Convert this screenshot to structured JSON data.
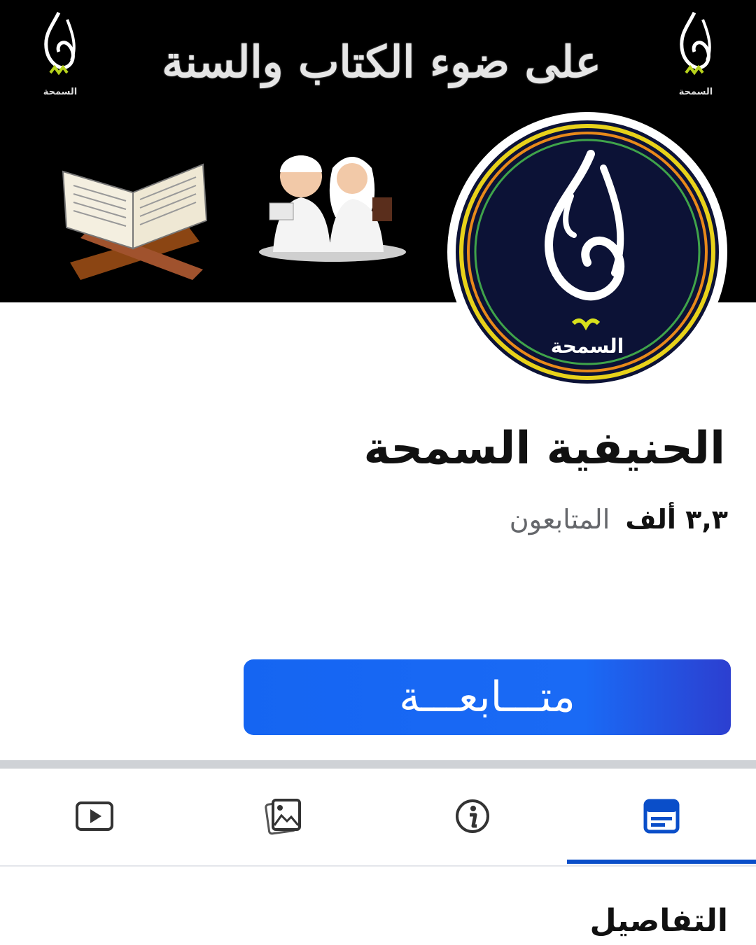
{
  "cover": {
    "title": "على ضوء الكتاب والسنة",
    "corner_logo_text": "السمحة"
  },
  "profile": {
    "avatar_caption": "السمحة",
    "name": "الحنيفية السمحة",
    "followers_count": "٣,٣ ألف",
    "followers_label": "المتابعون"
  },
  "actions": {
    "follow_label": "متـــابعـــة"
  },
  "tabs": [
    {
      "icon": "video-icon",
      "active": false
    },
    {
      "icon": "photos-icon",
      "active": false
    },
    {
      "icon": "info-icon",
      "active": false
    },
    {
      "icon": "posts-icon",
      "active": true
    }
  ],
  "section": {
    "title": "التفاصيل"
  },
  "colors": {
    "accent": "#1565f2",
    "active_tab": "#0a4ec9",
    "avatar_bg": "#0c1236",
    "ring_yellow": "#e8d21a",
    "ring_orange": "#e8891a"
  }
}
